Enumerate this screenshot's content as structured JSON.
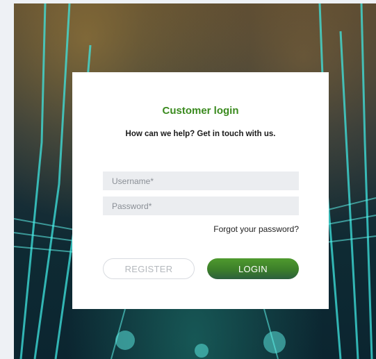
{
  "login": {
    "title": "Customer login",
    "subtitle": "How can we help? Get in touch with us.",
    "username_placeholder": "Username*",
    "password_placeholder": "Password*",
    "forgot_label": "Forgot your password?",
    "register_label": "REGISTER",
    "login_label": "LOGIN"
  },
  "colors": {
    "title_green": "#3a8a1e",
    "login_button_green": "#3c7e2a",
    "page_background": "#eef1f5",
    "circuit_cyan": "#3fe6e0"
  }
}
